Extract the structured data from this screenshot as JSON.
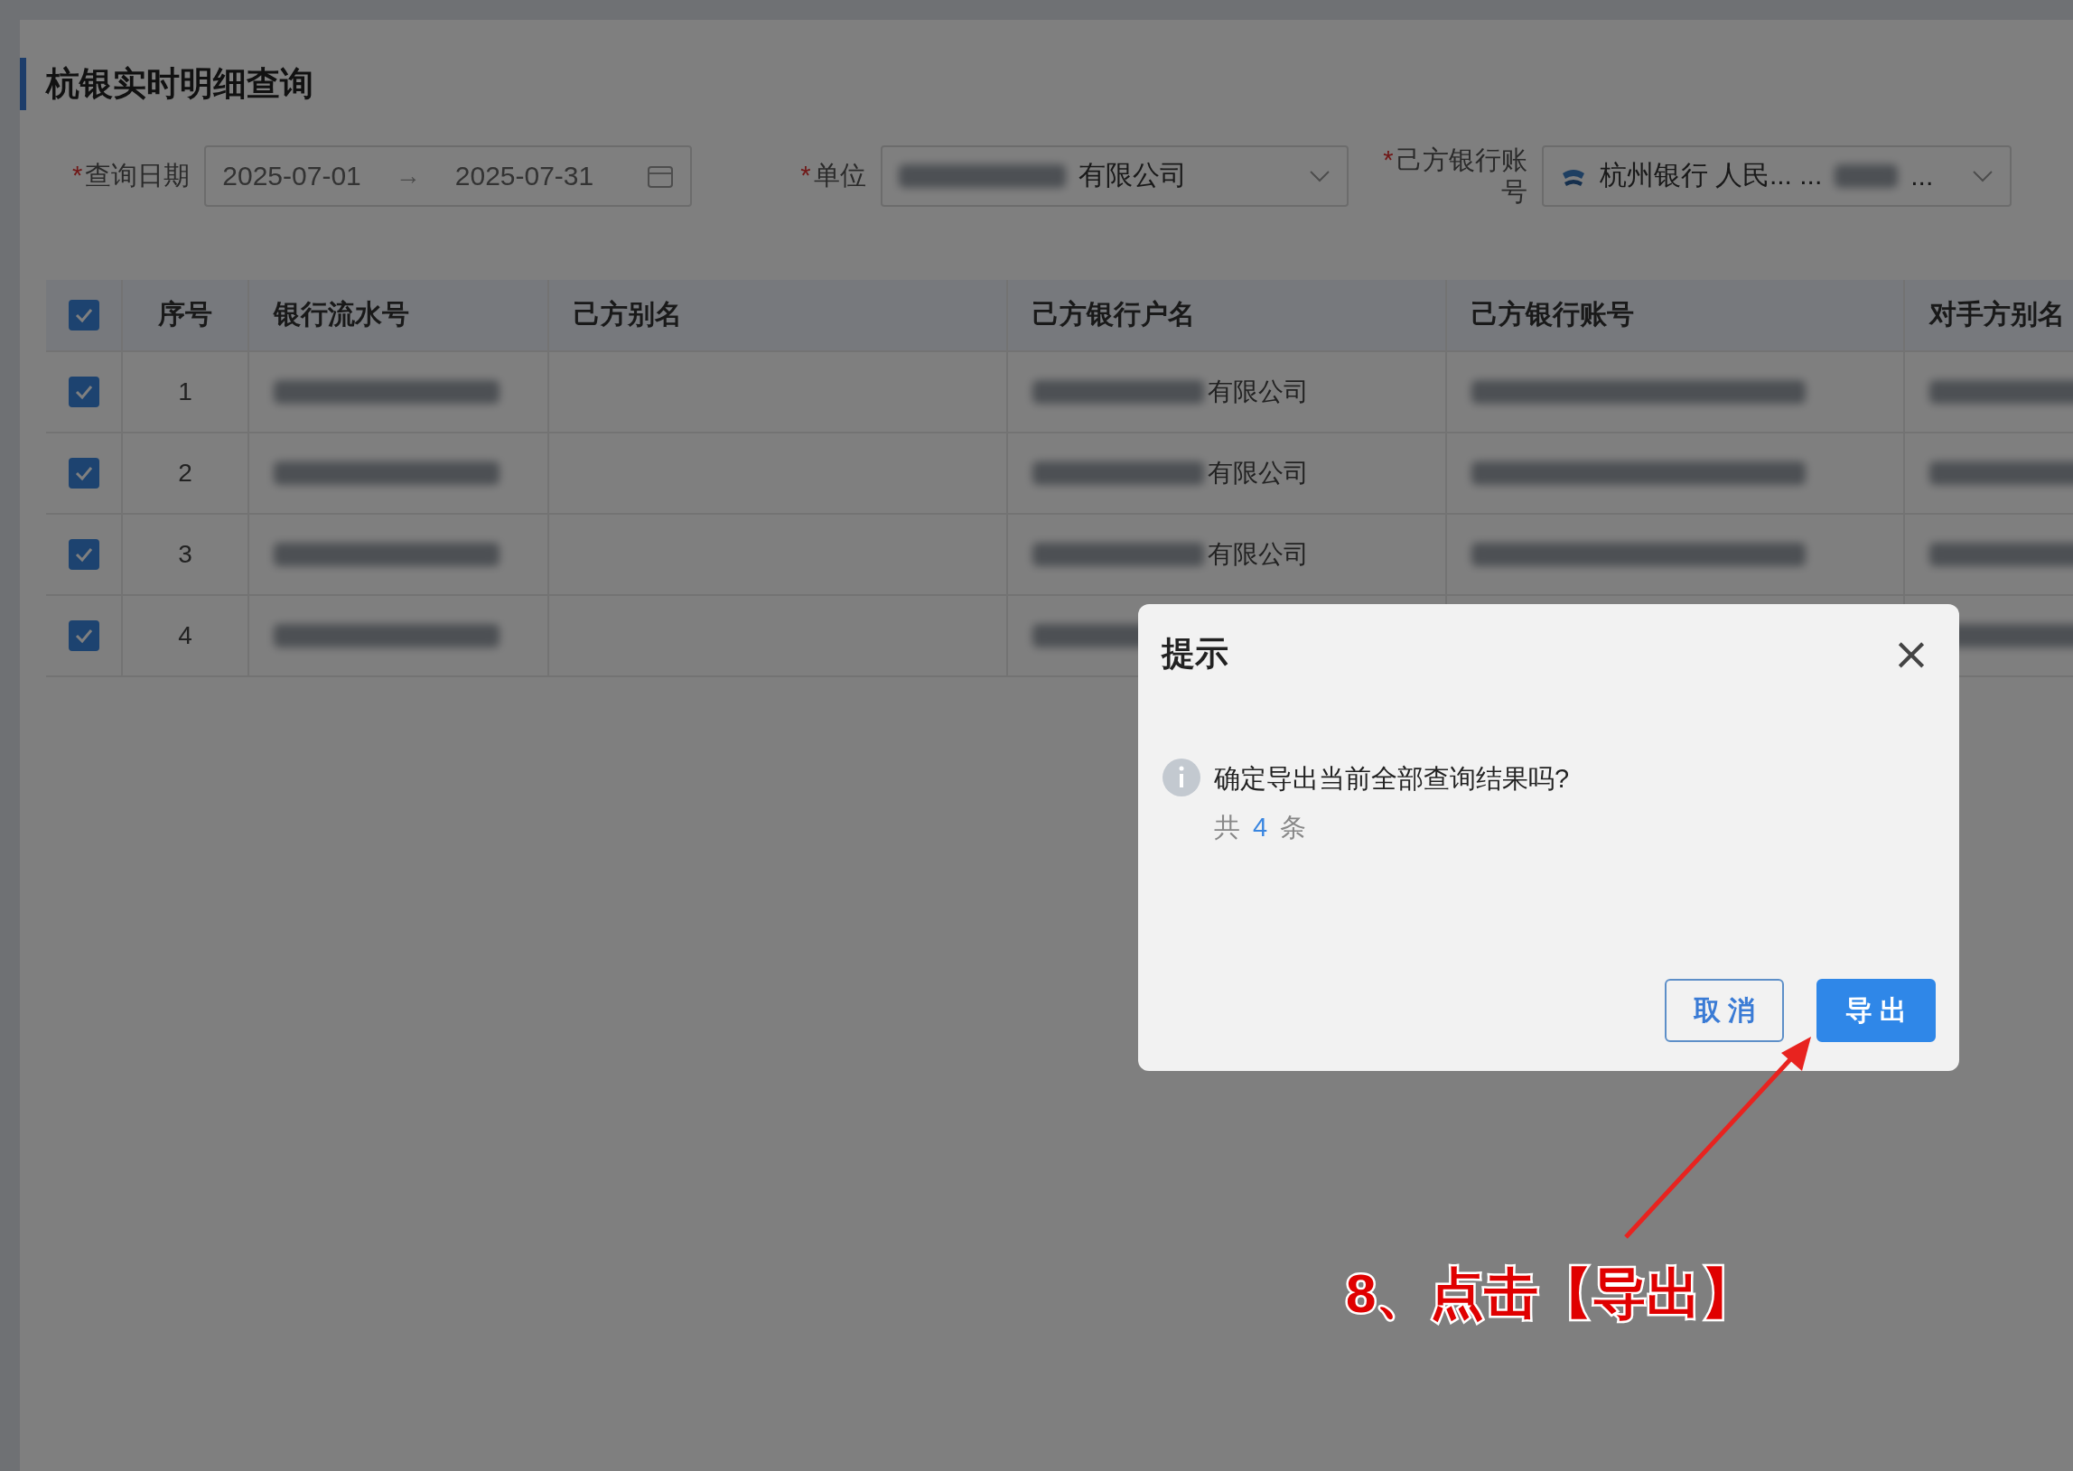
{
  "page": {
    "title": "杭银实时明细查询"
  },
  "filters": [
    {
      "kind": "daterange",
      "label": "查询日期",
      "required_mark": "*",
      "start": "2025-07-01",
      "separator": "→",
      "end": "2025-07-31"
    },
    {
      "kind": "select",
      "label": "单位",
      "required_mark": "*",
      "redacted_prefix": true,
      "value": "有限公司"
    },
    {
      "kind": "account",
      "label": "己方银行账号",
      "required_mark": "*",
      "value": "杭州银行 人民... ...",
      "redacted_suffix": true,
      "tail": "..."
    }
  ],
  "table": {
    "all_checked": true,
    "columns": [
      "序号",
      "银行流水号",
      "己方别名",
      "己方银行户名",
      "己方银行账号",
      "对手方别名"
    ],
    "rows": [
      {
        "checked": true,
        "index": "1",
        "account_name": "有限公司"
      },
      {
        "checked": true,
        "index": "2",
        "account_name": "有限公司"
      },
      {
        "checked": true,
        "index": "3",
        "account_name": "有限公司"
      },
      {
        "checked": true,
        "index": "4"
      }
    ]
  },
  "dialog": {
    "title": "提示",
    "close": "×",
    "message": "确定导出当前全部查询结果吗?",
    "count_prefix": "共",
    "count": "4",
    "count_suffix": "条",
    "buttons": [
      {
        "kind": "default",
        "label": "取 消"
      },
      {
        "kind": "primary",
        "label": "导 出"
      }
    ]
  },
  "annotation": {
    "text": "8、点击【导出】"
  }
}
